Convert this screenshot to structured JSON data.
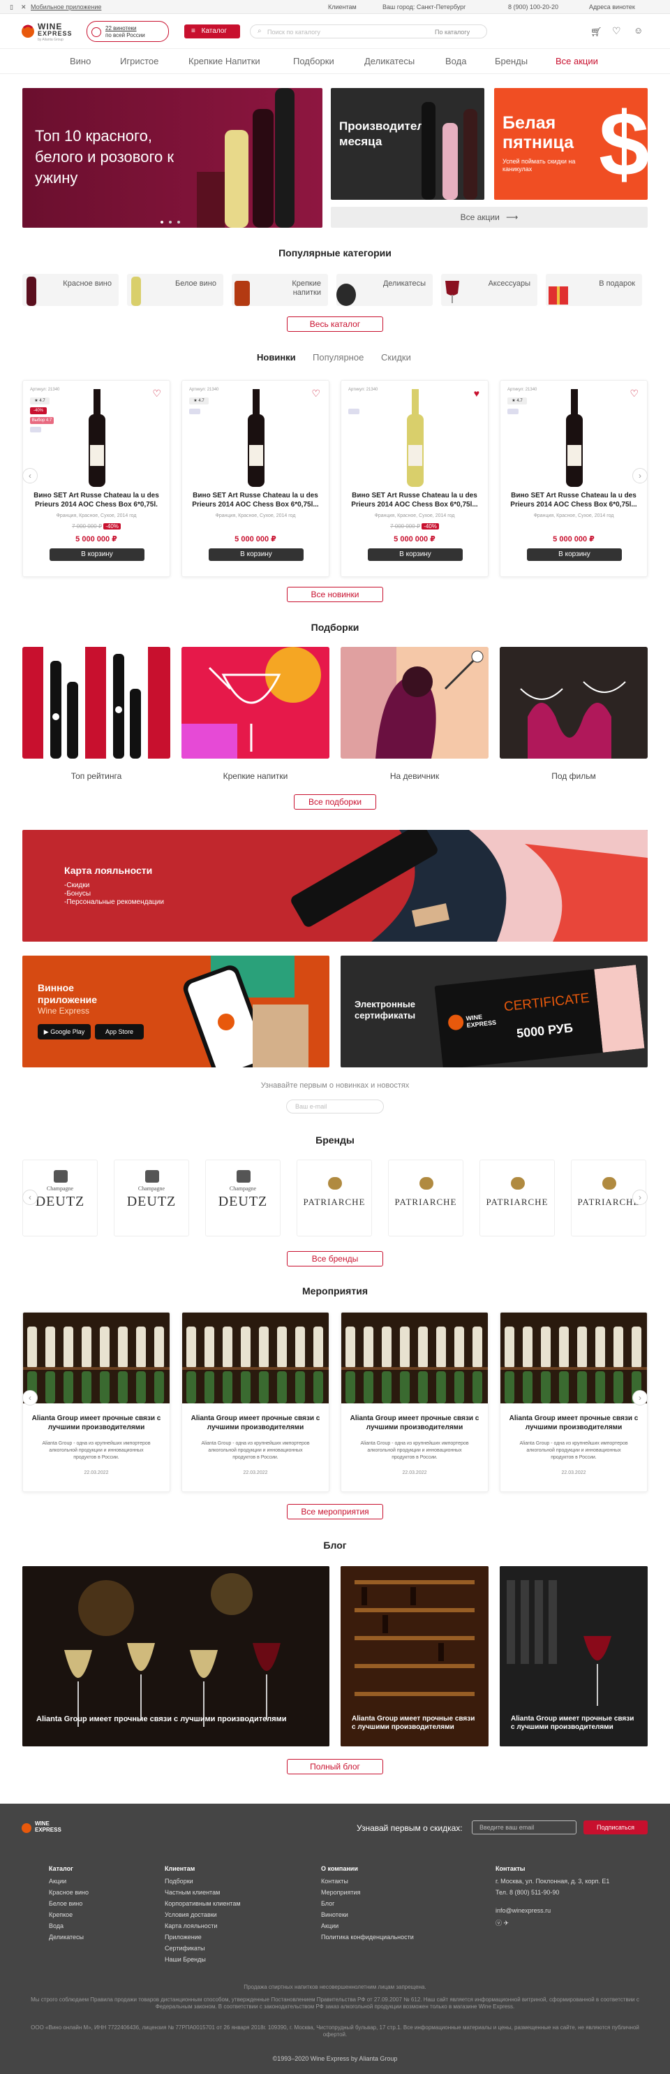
{
  "topbar": {
    "mobile_app": "Мобильное приложение",
    "clients": "Клиентам",
    "city": "Ваш город: Санкт-Петербург",
    "phone": "8 (900) 100-20-20",
    "shops": "Адреса винотек"
  },
  "header": {
    "logo_line1": "WINE",
    "logo_line2": "EXPRESS",
    "logo_sub": "by Alianta Group",
    "promo_line1": "22 винотеки",
    "promo_line2": "по всей России",
    "catalog_button": "Каталог",
    "search_placeholder": "Поиск по каталогу",
    "search_scope": "По каталогу"
  },
  "nav": [
    "Вино",
    "Игристое",
    "Крепкие Напитки",
    "Подборки",
    "Деликатесы",
    "Вода",
    "Бренды",
    "Все акции"
  ],
  "hero": {
    "main_title": "Топ 10 красного, белого и розового к ужину",
    "producer_title": "Производитель месяца",
    "friday_title": "Белая пятница",
    "friday_sub": "Успей поймать скидки на каникулах",
    "all_promos": "Все акции"
  },
  "categories": {
    "title": "Популярные категории",
    "items": [
      "Красное вино",
      "Белое вино",
      "Крепкие напитки",
      "Деликатесы",
      "Аксессуары",
      "В подарок"
    ],
    "all": "Весь каталог"
  },
  "products": {
    "tabs": [
      "Новинки",
      "Популярное",
      "Скидки"
    ],
    "items": [
      {
        "art": "Артикул: 21340",
        "rating": "4.7",
        "badges": [
          "-40%",
          "Выбор 4.7"
        ],
        "name": "Вино SET Art Russe Chateau la u des Prieurs 2014 AOC Chess Box 6*0,75l.",
        "meta": "Франция, Красное, Сухое, 2014 год",
        "old": "7 000 000 ₽",
        "disc": "-40%",
        "price": "5 000 000 ₽",
        "cart": "В корзину",
        "fav": false
      },
      {
        "art": "Артикул: 21340",
        "rating": "4.7",
        "badges": [],
        "name": "Вино SET Art Russe Chateau la u des Prieurs 2014 AOC Chess Box 6*0,75l...",
        "meta": "Франция, Красное, Сухое, 2014 год",
        "old": "",
        "disc": "",
        "price": "5 000 000 ₽",
        "cart": "В корзину",
        "fav": false
      },
      {
        "art": "Артикул: 21340",
        "rating": "",
        "badges": [],
        "name": "Вино SET Art Russe Chateau la u des Prieurs 2014 AOC Chess Box 6*0,75l...",
        "meta": "Франция, Красное, Сухое, 2014 год",
        "old": "7 000 000 ₽",
        "disc": "-40%",
        "price": "5 000 000 ₽",
        "cart": "В корзину",
        "fav": true
      },
      {
        "art": "Артикул: 21340",
        "rating": "4.7",
        "badges": [],
        "name": "Вино SET Art Russe Chateau la u des Prieurs 2014 AOC Chess Box 6*0,75l...",
        "meta": "Франция, Красное, Сухое, 2014 год",
        "old": "",
        "disc": "",
        "price": "5 000 000 ₽",
        "cart": "В корзину",
        "fav": false
      }
    ],
    "all": "Все новинки"
  },
  "selections": {
    "title": "Подборки",
    "items": [
      "Топ рейтинга",
      "Крепкие напитки",
      "На девичник",
      "Под фильм"
    ],
    "all": "Все подборки"
  },
  "loyalty": {
    "title": "Карта лояльности",
    "items": [
      "-Скидки",
      "-Бонусы",
      "-Персональные рекомендации"
    ]
  },
  "app": {
    "title_line1": "Винное",
    "title_line2": "приложение",
    "title_line3": "Wine Express",
    "google": "Google Play",
    "apple": "App Store"
  },
  "certs": {
    "title_line1": "Электронные",
    "title_line2": "сертификаты",
    "cert_word": "CERTIFICATE",
    "amount": "5000 РУБ"
  },
  "subscribe": {
    "title": "Узнавайте первым о новинках и новостях",
    "placeholder": "Ваш e-mail"
  },
  "brands": {
    "title": "Бренды",
    "items": [
      "DEUTZ",
      "DEUTZ",
      "DEUTZ",
      "PATRIARCHE",
      "PATRIARCHE",
      "PATRIARCHE",
      "PATRIARCHE"
    ],
    "all": "Все бренды"
  },
  "events": {
    "title": "Мероприятия",
    "items": [
      {
        "title": "Alianta Group имеет прочные связи с лучшими производителями",
        "desc": "Alianta Group - одна из крупнейших импортеров алкогольной продукции и инновационных продуктов в России.",
        "date": "22.03.2022"
      },
      {
        "title": "Alianta Group имеет прочные связи с лучшими производителями",
        "desc": "Alianta Group - одна из крупнейших импортеров алкогольной продукции и инновационных продуктов в России.",
        "date": "22.03.2022"
      },
      {
        "title": "Alianta Group имеет прочные связи с лучшими производителями",
        "desc": "Alianta Group - одна из крупнейших импортеров алкогольной продукции и инновационных продуктов в России.",
        "date": "22.03.2022"
      },
      {
        "title": "Alianta Group имеет прочные связи с лучшими производителями",
        "desc": "Alianta Group - одна из крупнейших импортеров алкогольной продукции и инновационных продуктов в России.",
        "date": "22.03.2022"
      }
    ],
    "all": "Все мероприятия"
  },
  "blog": {
    "title": "Блог",
    "items": [
      "Alianta Group имеет прочные связи с лучшими производителями",
      "Alianta Group имеет прочные связи с лучшими производителями",
      "Alianta Group имеет прочные связи с лучшими производителями"
    ],
    "all": "Полный блог"
  },
  "footer": {
    "subscribe_text": "Узнавай первым о скидках:",
    "email_placeholder": "Введите ваш email",
    "subscribe_btn": "Подписаться",
    "col1": {
      "h": "Каталог",
      "items": [
        "Акции",
        "Красное вино",
        "Белое вино",
        "Крепкое",
        "Вода",
        "Деликатесы"
      ]
    },
    "col2": {
      "h": "Клиентам",
      "items": [
        "Подборки",
        "Частным клиентам",
        "Корпоративным клиентам",
        "Условия доставки",
        "Карта лояльности",
        "Приложение",
        "Сертификаты",
        "Наши Бренды"
      ]
    },
    "col3": {
      "h": "О компании",
      "items": [
        "Контакты",
        "Мероприятия",
        "Блог",
        "Винотеки",
        "Акции",
        "Политика конфиденциальности"
      ]
    },
    "col4": {
      "h": "Контакты",
      "items": [
        "г. Москва, ул. Поклонная, д. 3, корп. Е1",
        "Тел. 8 (800) 511-90-90",
        "info@winexpress.ru"
      ]
    },
    "legal1": "Продажа спиртных напитков несовершеннолетним лицам запрещена.",
    "legal2": "Мы строго соблюдаем Правила продажи товаров дистанционным способом, утвержденные Постановлением Правительства РФ от 27.09.2007 № 612. Наш сайт является информационной витриной, сформированной в соответствии с Федеральным законом. В соответствии с законодательством РФ заказ алкогольной продукции возможен только в магазине Wine Express.",
    "legal3": "ООО «Вино онлайн М», ИНН 7722406436, лицензия № 77РПА0015701 от 26 января 2018г. 109390, г. Москва, Чистопрудный бульвар, 17 стр.1. Все информационные материалы и цены, размещенные на сайте, не являются публичной офертой.",
    "copyright": "©1993–2020 Wine Express by Alianta Group"
  }
}
